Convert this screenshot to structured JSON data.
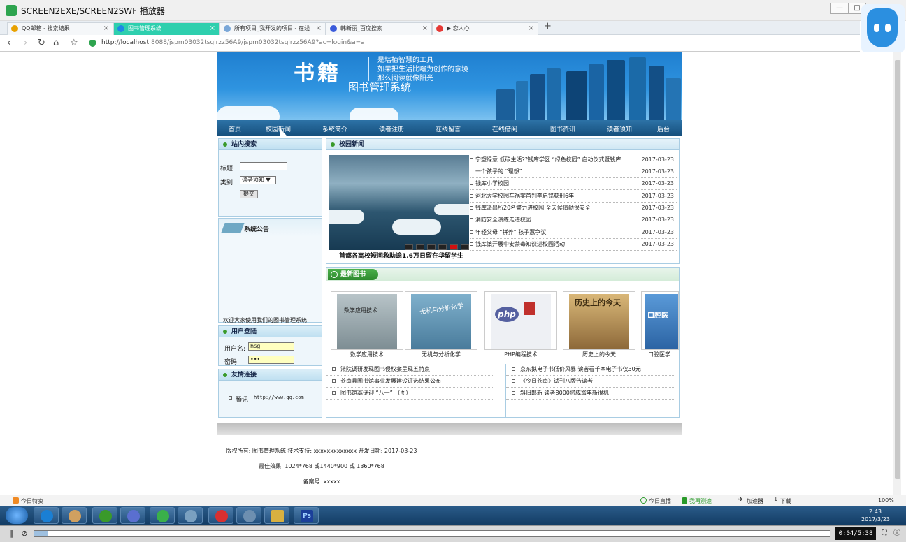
{
  "window": {
    "title": "SCREEN2EXE/SCREEN2SWF 播放器",
    "minimize": "—",
    "maximize": "□"
  },
  "browser": {
    "tabs": [
      {
        "label": "QQ邮箱 - 搜索结果",
        "icon_color": "#e8a100"
      },
      {
        "label": "图书管理系统",
        "icon_color": "#1e88e5",
        "active": true
      },
      {
        "label": "所有项目_我开发的项目 - 在线",
        "icon_color": "#7aa7d8"
      },
      {
        "label": "韩新丽_百度搜索",
        "icon_color": "#3b5bdb"
      },
      {
        "label": "▶ 恋人心",
        "icon_color": "#e53935"
      }
    ],
    "close_glyph": "×",
    "new_tab": "+",
    "nav": {
      "back": "‹",
      "forward": "›",
      "reload": "↻",
      "home": "⌂",
      "star": "☆"
    },
    "url_host": "http://localhost",
    "url_rest": ":8088/jspm03032tsglrzz56A9/jspm03032tsglrzz56A9?ac=login&a=a"
  },
  "site": {
    "banner": {
      "title": "书籍",
      "slogan": [
        "是培植智慧的工具",
        "如果把生活比喻为创作的意境",
        "那么阅读就像阳光"
      ],
      "subtitle": "图书管理系统"
    },
    "menu": [
      "首页",
      "校园新闻",
      "系统简介",
      "读者注册",
      "在线留言",
      "在线借阅",
      "图书资讯",
      "读者须知",
      "后台"
    ],
    "search": {
      "header": "站内搜索",
      "title_label": "标题",
      "title_value": "",
      "category_label": "类别",
      "category_value": "读者须知 ▼",
      "submit": "提交"
    },
    "notice": {
      "header": "系统公告",
      "marquee": "欢迎大家使用我们的图书管理系统"
    },
    "login": {
      "header": "用户登陆",
      "user_label": "用户名:",
      "user_value": "hsg",
      "pass_label": "密码:",
      "pass_value": "•••"
    },
    "links": {
      "header": "友情连接",
      "items": [
        {
          "name": "腾讯",
          "url": "http://www.qq.com"
        }
      ]
    },
    "news": {
      "header": "校园新闻",
      "caption": "首都各高校短间救助逾1.6万日留在华留学生",
      "items": [
        {
          "title": "宁塑绿意 低碳生活??钱库学区 “绿色校园” 启动仪式暨钱库...",
          "date": "2017-03-23"
        },
        {
          "title": "一个孩子的 “理想”",
          "date": "2017-03-23"
        },
        {
          "title": "钱库小学校园",
          "date": "2017-03-23"
        },
        {
          "title": "河北大学校园车祸案首判李启铭获刑6年",
          "date": "2017-03-23"
        },
        {
          "title": "钱库派出所20名警力进校园 全天候值勤保安全",
          "date": "2017-03-23"
        },
        {
          "title": "消防安全演练走进校园",
          "date": "2017-03-23"
        },
        {
          "title": "年轻父母 “拼养” 孩子惹争议",
          "date": "2017-03-23"
        },
        {
          "title": "钱库镇开展中安禁毒知识进校园活动",
          "date": "2017-03-23"
        }
      ]
    },
    "books": {
      "header": "最新图书",
      "items": [
        {
          "name": "数学应用技术",
          "cover_text": "数学应用技术",
          "color": "#8a9aa0"
        },
        {
          "name": "无机与分析化学",
          "cover_text": "无机与分析化学",
          "color": "#5f8fae"
        },
        {
          "name": "PHP编程技术",
          "cover_text": "php",
          "color": "#eef0f4"
        },
        {
          "name": "历史上的今天",
          "cover_text": "历史上的今天",
          "color": "#b58a4c"
        },
        {
          "name": "口腔医学",
          "cover_text": "口腔医",
          "color": "#3c7fc0"
        }
      ]
    },
    "info_left": [
      "法院调研发现图书侵权案呈现五特点",
      "苍南县图书馆事业发展建设评选结果公布",
      "图书馆寡谜迎 “八一” （图）"
    ],
    "info_right": [
      "京东拟电子书低价风暴 读者看千本电子书仅30元",
      "《今日苍南》试刊八版告读者",
      "斜旧郎新 读者8000将成翁年新很机"
    ],
    "footer": [
      "版权所有: 图书管理系统 技术支持: xxxxxxxxxxxxx 开发日期: 2017-03-23",
      "最佳效果: 1024*768 或1440*900 或 1360*768",
      "备案号: xxxxx"
    ]
  },
  "statusbar": {
    "left": "今日特卖",
    "items": [
      "今日直播",
      "我再测速",
      "加速器",
      "下载",
      "100%"
    ]
  },
  "taskbar": {
    "time": "2:43",
    "date": "2017/3/23",
    "tasks": [
      "#1a7fd4",
      "#d0a060",
      "#3a9a2a",
      "#5a6fd0",
      "#3ab04a",
      "#7aa0c0",
      "#d83030",
      "#6d8fb0",
      "#d8b040",
      "#1b3f9a"
    ],
    "ps_label": "Ps"
  },
  "player": {
    "pause": "‖",
    "stop": "⊘",
    "time": "0:04/5:38",
    "progress": 0.012
  }
}
